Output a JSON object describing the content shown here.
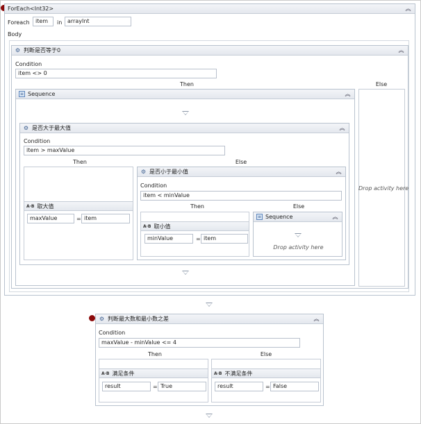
{
  "foreach": {
    "title": "ForEach<Int32>",
    "foreach_label": "Foreach",
    "item_value": "item",
    "in_label": "in",
    "collection_value": "arrayInt",
    "body_label": "Body"
  },
  "if_zero": {
    "title": "判断是否等于0",
    "condition_label": "Condition",
    "condition": "item <> 0",
    "then_label": "Then",
    "else_label": "Else",
    "drop_text": "Drop activity here"
  },
  "sequence_main": {
    "title": "Sequence"
  },
  "if_max": {
    "title": "是否大于最大值",
    "condition_label": "Condition",
    "condition": "item > maxValue",
    "then_label": "Then",
    "else_label": "Else"
  },
  "assign_max": {
    "title": "取大值",
    "to": "maxValue",
    "eq": "=",
    "value": "item"
  },
  "if_min": {
    "title": "是否小于最小值",
    "condition_label": "Condition",
    "condition": "item < minValue",
    "then_label": "Then",
    "else_label": "Else"
  },
  "assign_min": {
    "title": "取小值",
    "to": "minValue",
    "eq": "=",
    "value": "item"
  },
  "sequence_inner": {
    "title": "Sequence",
    "drop_text": "Drop activity here"
  },
  "if_diff": {
    "title": "判断最大数和最小数之差",
    "condition_label": "Condition",
    "condition": "maxValue - minValue <= 4",
    "then_label": "Then",
    "else_label": "Else"
  },
  "assign_true": {
    "title": "满足条件",
    "to": "result",
    "eq": "=",
    "value": "True"
  },
  "assign_false": {
    "title": "不满足条件",
    "to": "result",
    "eq": "=",
    "value": "False"
  },
  "icons": {
    "collapse": "collapse-chevrons-icon",
    "if": "if-flowchart-icon",
    "sequence": "sequence-icon",
    "assign": "assign-ab-icon",
    "breakpoint": "breakpoint-icon",
    "drop_arrow": "drop-arrow-icon"
  },
  "colors": {
    "breakpoint": "#8b0a0a",
    "header": "#e4e8ee",
    "border": "#b8c2ce"
  }
}
